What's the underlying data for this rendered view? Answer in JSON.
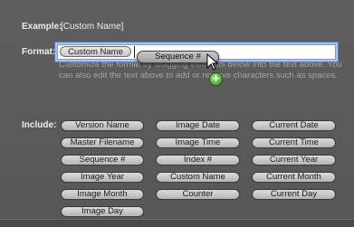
{
  "example": {
    "label": "Example:",
    "value": "[Custom Name]"
  },
  "format": {
    "label": "Format:",
    "field_tokens": [
      "Custom Name"
    ],
    "dragged_token": "Sequence #",
    "help_text": "Customize the format by dragging elements below into the text above. You can also edit the text above to add or remove characters such as spaces."
  },
  "include": {
    "label": "Include:",
    "tokens": [
      [
        "Version Name",
        "Image Date",
        "Current Date"
      ],
      [
        "Master Filename",
        "Image Time",
        "Current Time"
      ],
      [
        "Sequence #",
        "Index #",
        "Current Year"
      ],
      [
        "Image Year",
        "Custom Name",
        "Current Month"
      ],
      [
        "Image Month",
        "Counter",
        "Current Day"
      ],
      [
        "Image Day"
      ]
    ]
  },
  "icons": {
    "pointer": "arrow-cursor-icon",
    "copy_badge": "plus-icon"
  }
}
